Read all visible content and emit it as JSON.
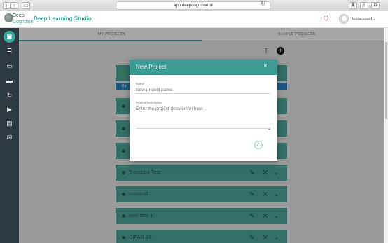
{
  "browser": {
    "url": "app.deepcognition.ai",
    "back_icon": "chevron-left-icon",
    "forward_icon": "chevron-right-icon"
  },
  "header": {
    "logo_line1": "Deep",
    "logo_line2": "Cognition",
    "title": "Deep Learning Studio",
    "username": "testaccount"
  },
  "tabs": [
    {
      "label": "MY PROJECTS",
      "active": true
    },
    {
      "label": "SAMPLE PROJECTS",
      "active": false
    }
  ],
  "sidebar": {
    "items": [
      {
        "icon": "projects-icon",
        "active": true
      },
      {
        "icon": "datasets-icon"
      },
      {
        "icon": "folder-icon"
      },
      {
        "icon": "laptop-icon"
      },
      {
        "icon": "refresh-icon"
      },
      {
        "icon": "video-icon"
      },
      {
        "icon": "id-card-icon"
      },
      {
        "icon": "mail-icon"
      }
    ]
  },
  "projects": [
    {
      "name": "Trendata Test"
    },
    {
      "name": "sravani1"
    },
    {
      "name": "vish-test-1"
    },
    {
      "name": "CIFAR 10"
    }
  ],
  "blue_strip_label": "Ru",
  "modal": {
    "title": "New Project",
    "name_label": "Name",
    "name_placeholder": "New project name",
    "desc_label": "Project Description",
    "desc_placeholder": "Enter the project description here..."
  },
  "colors": {
    "accent": "#38a89d",
    "card": "#4faa9f",
    "sidebar": "#2e3a42",
    "power": "#e23b2e"
  }
}
